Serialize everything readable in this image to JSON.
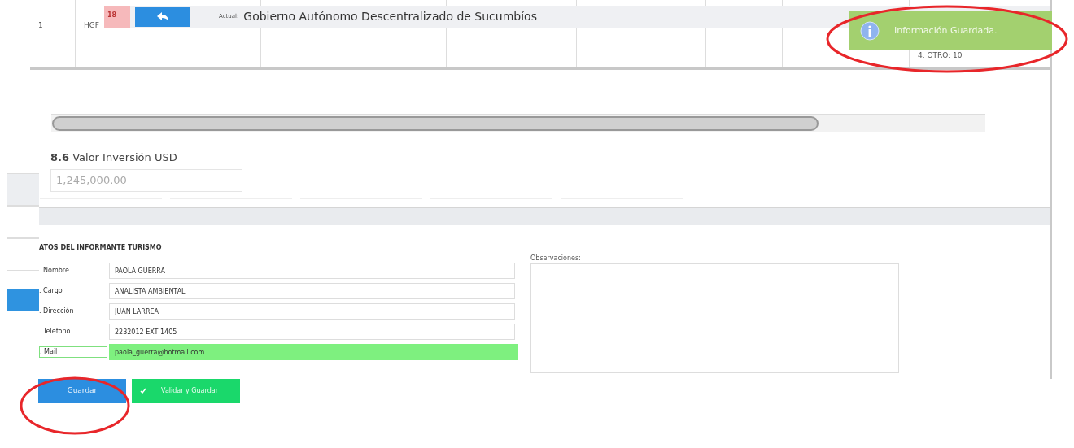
{
  "table": {
    "rows": [
      {
        "cells": [
          "1",
          "HGF",
          "",
          "",
          "",
          "",
          "",
          "4. OTRO: 10"
        ]
      }
    ]
  },
  "header": {
    "badge": "18",
    "actual_label": "Actual:",
    "title": "Gobierno Autónomo Descentralizado de Sucumbíos"
  },
  "toast": {
    "message": "Información Guardada."
  },
  "investment": {
    "label": "**8.6** Valor Inversión USD",
    "value": "1,245,000.00",
    "disabled": true
  },
  "informant": {
    "heading": "ATOS DEL INFORMANTE TURISMO",
    "fields": [
      {
        "label": ". Nombre",
        "value": "PAOLA GUERRA",
        "valid": false
      },
      {
        "label": ". Cargo",
        "value": "ANALISTA AMBIENTAL",
        "valid": false
      },
      {
        "label": ". Dirección",
        "value": "JUAN LARREA",
        "valid": false
      },
      {
        "label": ". Telefono",
        "value": "2232012 EXT 1405",
        "valid": false
      },
      {
        "label": ". Mail",
        "value": "paola_guerra@hotmail.com",
        "valid": true
      }
    ],
    "observations_label": "Observaciones:"
  },
  "buttons": [
    {
      "label": "Guardar",
      "kind": "primary"
    },
    {
      "label": "Validar y Guardar",
      "kind": "validate"
    }
  ]
}
